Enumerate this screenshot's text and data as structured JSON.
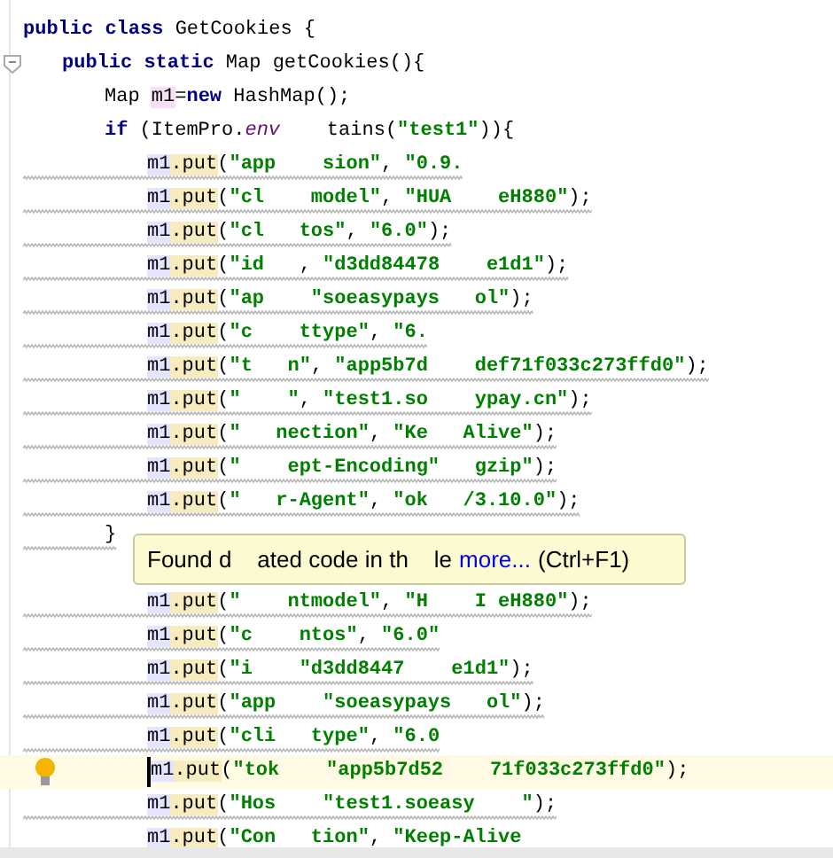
{
  "editor": {
    "lines": [
      {
        "tokens": [
          {
            "kind": "keyword",
            "text": "public class"
          },
          {
            "kind": "plain",
            "text": " GetCookies {"
          }
        ],
        "fold": false,
        "warning": false,
        "current": false,
        "children": [
          {
            "tokens": [
              {
                "kind": "keyword",
                "text": "public static"
              },
              {
                "kind": "plain",
                "text": " Map getCookies(){"
              }
            ],
            "fold": true,
            "warning": false,
            "current": false,
            "children": [
              {
                "tokens": [
                  {
                    "kind": "plain",
                    "text": "Map "
                  },
                  {
                    "kind": "usage",
                    "text": "m1"
                  },
                  {
                    "kind": "plain",
                    "text": "="
                  },
                  {
                    "kind": "keyword",
                    "text": "new"
                  },
                  {
                    "kind": "plain",
                    "text": " HashMap();"
                  }
                ],
                "fold": false,
                "warning": false,
                "current": false
              },
              {
                "tokens": [
                  {
                    "kind": "keyword",
                    "text": "if"
                  },
                  {
                    "kind": "plain",
                    "text": " (ItemPro."
                  },
                  {
                    "kind": "field",
                    "text": "env"
                  },
                  {
                    "kind": "plain",
                    "text": "    tains("
                  },
                  {
                    "kind": "string",
                    "text": "\"test1\""
                  },
                  {
                    "kind": "plain",
                    "text": ")){"
                  }
                ],
                "fold": false,
                "warning": false,
                "current": false,
                "children": [
                  {
                    "tokens": [
                      {
                        "kind": "dup_var",
                        "text": "m1"
                      },
                      {
                        "kind": "dup_call",
                        "text": ".put"
                      },
                      {
                        "kind": "plain",
                        "text": "("
                      },
                      {
                        "kind": "string",
                        "text": "\"app    sion\""
                      },
                      {
                        "kind": "plain",
                        "text": ", "
                      },
                      {
                        "kind": "string",
                        "text": "\"0.9."
                      }
                    ],
                    "fold": false,
                    "warning": true,
                    "current": false
                  },
                  {
                    "tokens": [
                      {
                        "kind": "dup_var",
                        "text": "m1"
                      },
                      {
                        "kind": "dup_call",
                        "text": ".put"
                      },
                      {
                        "kind": "plain",
                        "text": "("
                      },
                      {
                        "kind": "string",
                        "text": "\"cl    model\""
                      },
                      {
                        "kind": "plain",
                        "text": ", "
                      },
                      {
                        "kind": "string",
                        "text": "\"HUA    eH880\""
                      },
                      {
                        "kind": "plain",
                        "text": ");"
                      }
                    ],
                    "fold": false,
                    "warning": true,
                    "current": false
                  },
                  {
                    "tokens": [
                      {
                        "kind": "dup_var",
                        "text": "m1"
                      },
                      {
                        "kind": "dup_call",
                        "text": ".put"
                      },
                      {
                        "kind": "plain",
                        "text": "("
                      },
                      {
                        "kind": "string",
                        "text": "\"cl   tos\""
                      },
                      {
                        "kind": "plain",
                        "text": ", "
                      },
                      {
                        "kind": "string",
                        "text": "\"6.0\""
                      },
                      {
                        "kind": "plain",
                        "text": ");"
                      }
                    ],
                    "fold": false,
                    "warning": true,
                    "current": false
                  },
                  {
                    "tokens": [
                      {
                        "kind": "dup_var",
                        "text": "m1"
                      },
                      {
                        "kind": "dup_call",
                        "text": ".put"
                      },
                      {
                        "kind": "plain",
                        "text": "("
                      },
                      {
                        "kind": "string",
                        "text": "\"id   "
                      },
                      {
                        "kind": "plain",
                        "text": ", "
                      },
                      {
                        "kind": "string",
                        "text": "\"d3dd84478    e1d1\""
                      },
                      {
                        "kind": "plain",
                        "text": ");"
                      }
                    ],
                    "fold": false,
                    "warning": true,
                    "current": false
                  },
                  {
                    "tokens": [
                      {
                        "kind": "dup_var",
                        "text": "m1"
                      },
                      {
                        "kind": "dup_call",
                        "text": ".put"
                      },
                      {
                        "kind": "plain",
                        "text": "("
                      },
                      {
                        "kind": "string",
                        "text": "\"ap    \"soeasypays   ol\""
                      },
                      {
                        "kind": "plain",
                        "text": ");"
                      }
                    ],
                    "fold": false,
                    "warning": true,
                    "current": false
                  },
                  {
                    "tokens": [
                      {
                        "kind": "dup_var",
                        "text": "m1"
                      },
                      {
                        "kind": "dup_call",
                        "text": ".put"
                      },
                      {
                        "kind": "plain",
                        "text": "("
                      },
                      {
                        "kind": "string",
                        "text": "\"c    ttype\""
                      },
                      {
                        "kind": "plain",
                        "text": ", "
                      },
                      {
                        "kind": "string",
                        "text": "\"6."
                      }
                    ],
                    "fold": false,
                    "warning": true,
                    "current": false
                  },
                  {
                    "tokens": [
                      {
                        "kind": "dup_var",
                        "text": "m1"
                      },
                      {
                        "kind": "dup_call",
                        "text": ".put"
                      },
                      {
                        "kind": "plain",
                        "text": "("
                      },
                      {
                        "kind": "string",
                        "text": "\"t   n\""
                      },
                      {
                        "kind": "plain",
                        "text": ", "
                      },
                      {
                        "kind": "string",
                        "text": "\"app5b7d    def71f033c273ffd0\""
                      },
                      {
                        "kind": "plain",
                        "text": ");"
                      }
                    ],
                    "fold": false,
                    "warning": true,
                    "current": false
                  },
                  {
                    "tokens": [
                      {
                        "kind": "dup_var",
                        "text": "m1"
                      },
                      {
                        "kind": "dup_call",
                        "text": ".put"
                      },
                      {
                        "kind": "plain",
                        "text": "("
                      },
                      {
                        "kind": "string",
                        "text": "\"    \""
                      },
                      {
                        "kind": "plain",
                        "text": ", "
                      },
                      {
                        "kind": "string",
                        "text": "\"test1.so    ypay.cn\""
                      },
                      {
                        "kind": "plain",
                        "text": ");"
                      }
                    ],
                    "fold": false,
                    "warning": true,
                    "current": false
                  },
                  {
                    "tokens": [
                      {
                        "kind": "dup_var",
                        "text": "m1"
                      },
                      {
                        "kind": "dup_call",
                        "text": ".put"
                      },
                      {
                        "kind": "plain",
                        "text": "("
                      },
                      {
                        "kind": "string",
                        "text": "\"   nection\""
                      },
                      {
                        "kind": "plain",
                        "text": ", "
                      },
                      {
                        "kind": "string",
                        "text": "\"Ke   Alive\""
                      },
                      {
                        "kind": "plain",
                        "text": ");"
                      }
                    ],
                    "fold": false,
                    "warning": true,
                    "current": false
                  },
                  {
                    "tokens": [
                      {
                        "kind": "dup_var",
                        "text": "m1"
                      },
                      {
                        "kind": "dup_call",
                        "text": ".put"
                      },
                      {
                        "kind": "plain",
                        "text": "("
                      },
                      {
                        "kind": "string",
                        "text": "\"    ept-Encoding\"   gzip\""
                      },
                      {
                        "kind": "plain",
                        "text": ");"
                      }
                    ],
                    "fold": false,
                    "warning": true,
                    "current": false
                  },
                  {
                    "tokens": [
                      {
                        "kind": "dup_var",
                        "text": "m1"
                      },
                      {
                        "kind": "dup_call",
                        "text": ".put"
                      },
                      {
                        "kind": "plain",
                        "text": "("
                      },
                      {
                        "kind": "string",
                        "text": "\"   r-Agent\""
                      },
                      {
                        "kind": "plain",
                        "text": ", "
                      },
                      {
                        "kind": "string",
                        "text": "\"ok   /3.10.0\""
                      },
                      {
                        "kind": "plain",
                        "text": ");"
                      }
                    ],
                    "fold": false,
                    "warning": true,
                    "current": false
                  }
                ]
              },
              {
                "tokens": [
                  {
                    "kind": "plain",
                    "text": "}"
                  }
                ],
                "fold": false,
                "warning": true,
                "current": false,
                "tooltip": {
                  "message": "Found d    ated code in th    le",
                  "link": "more...",
                  "shortcut": "(Ctrl+F1)"
                },
                "children": [
                  {
                    "tokens": [
                      {
                        "kind": "dup_var",
                        "text": "m1"
                      },
                      {
                        "kind": "dup_call",
                        "text": ".put"
                      },
                      {
                        "kind": "plain",
                        "text": "("
                      },
                      {
                        "kind": "string",
                        "text": "\"    ntmodel\""
                      },
                      {
                        "kind": "plain",
                        "text": ", "
                      },
                      {
                        "kind": "string",
                        "text": "\"H    I eH880\""
                      },
                      {
                        "kind": "plain",
                        "text": ");"
                      }
                    ],
                    "fold": false,
                    "warning": true,
                    "current": false
                  },
                  {
                    "tokens": [
                      {
                        "kind": "dup_var",
                        "text": "m1"
                      },
                      {
                        "kind": "dup_call",
                        "text": ".put"
                      },
                      {
                        "kind": "plain",
                        "text": "("
                      },
                      {
                        "kind": "string",
                        "text": "\"c    ntos\""
                      },
                      {
                        "kind": "plain",
                        "text": ", "
                      },
                      {
                        "kind": "string",
                        "text": "\"6.0\""
                      }
                    ],
                    "fold": false,
                    "warning": true,
                    "current": false
                  },
                  {
                    "tokens": [
                      {
                        "kind": "dup_var",
                        "text": "m1"
                      },
                      {
                        "kind": "dup_call",
                        "text": ".put"
                      },
                      {
                        "kind": "plain",
                        "text": "("
                      },
                      {
                        "kind": "string",
                        "text": "\"i    \"d3dd8447    e1d1\""
                      },
                      {
                        "kind": "plain",
                        "text": ");"
                      }
                    ],
                    "fold": false,
                    "warning": true,
                    "current": false
                  },
                  {
                    "tokens": [
                      {
                        "kind": "dup_var",
                        "text": "m1"
                      },
                      {
                        "kind": "dup_call",
                        "text": ".put"
                      },
                      {
                        "kind": "plain",
                        "text": "("
                      },
                      {
                        "kind": "string",
                        "text": "\"app    \"soeasypays   ol\""
                      },
                      {
                        "kind": "plain",
                        "text": ");"
                      }
                    ],
                    "fold": false,
                    "warning": true,
                    "current": false
                  },
                  {
                    "tokens": [
                      {
                        "kind": "dup_var",
                        "text": "m1"
                      },
                      {
                        "kind": "dup_call",
                        "text": ".put"
                      },
                      {
                        "kind": "plain",
                        "text": "("
                      },
                      {
                        "kind": "string",
                        "text": "\"cli   type\""
                      },
                      {
                        "kind": "plain",
                        "text": ", "
                      },
                      {
                        "kind": "string",
                        "text": "\"6.0"
                      }
                    ],
                    "fold": false,
                    "warning": true,
                    "current": false
                  },
                  {
                    "tokens": [
                      {
                        "kind": "dup_var",
                        "text": "m1"
                      },
                      {
                        "kind": "dup_call",
                        "text": ".put"
                      },
                      {
                        "kind": "plain",
                        "text": "("
                      },
                      {
                        "kind": "string",
                        "text": "\"tok    \"app5b7d52    71f033c273ffd0\""
                      },
                      {
                        "kind": "plain",
                        "text": ");"
                      }
                    ],
                    "fold": false,
                    "warning": false,
                    "current": true
                  },
                  {
                    "tokens": [
                      {
                        "kind": "dup_var",
                        "text": "m1"
                      },
                      {
                        "kind": "dup_call",
                        "text": ".put"
                      },
                      {
                        "kind": "plain",
                        "text": "("
                      },
                      {
                        "kind": "string",
                        "text": "\"Hos    \"test1.soeasy    \""
                      },
                      {
                        "kind": "plain",
                        "text": ");"
                      }
                    ],
                    "fold": false,
                    "warning": true,
                    "current": false
                  },
                  {
                    "tokens": [
                      {
                        "kind": "dup_var",
                        "text": "m1"
                      },
                      {
                        "kind": "dup_call",
                        "text": ".put"
                      },
                      {
                        "kind": "plain",
                        "text": "("
                      },
                      {
                        "kind": "string",
                        "text": "\"Con   tion\""
                      },
                      {
                        "kind": "plain",
                        "text": ", "
                      },
                      {
                        "kind": "string",
                        "text": "\"Keep-Alive"
                      }
                    ],
                    "fold": false,
                    "current": false
                  }
                ]
              }
            ]
          }
        ]
      }
    ]
  }
}
